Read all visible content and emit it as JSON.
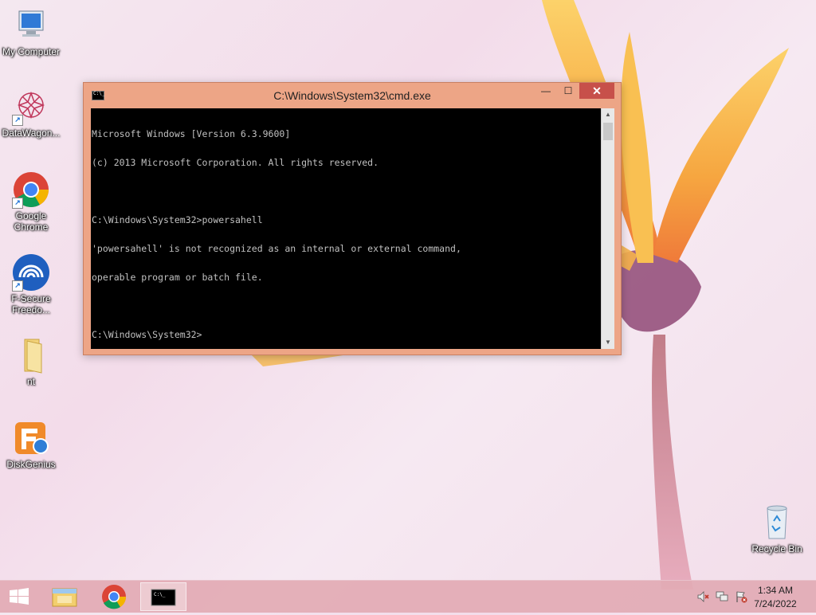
{
  "desktop": {
    "icons": [
      {
        "label": "My Computer"
      },
      {
        "label": "DataWagon..."
      },
      {
        "label": "Google Chrome"
      },
      {
        "label": "F-Secure Freedo..."
      },
      {
        "label": "nt"
      },
      {
        "label": "DiskGenius"
      },
      {
        "label": "Recycle Bin"
      }
    ]
  },
  "cmd_window": {
    "title": "C:\\Windows\\System32\\cmd.exe",
    "icon_text": "C:\\_",
    "buttons": {
      "minimize": "—",
      "maximize": "☐",
      "close": "✕"
    },
    "console_lines": [
      "Microsoft Windows [Version 6.3.9600]",
      "(c) 2013 Microsoft Corporation. All rights reserved.",
      "",
      "C:\\Windows\\System32>powersahell",
      "'powersahell' is not recognized as an internal or external command,",
      "operable program or batch file.",
      "",
      "C:\\Windows\\System32>"
    ]
  },
  "taskbar": {
    "items": [
      {
        "name": "file-explorer"
      },
      {
        "name": "google-chrome"
      },
      {
        "name": "command-prompt"
      }
    ],
    "clock": {
      "time": "1:34 AM",
      "date": "7/24/2022"
    }
  },
  "colors": {
    "window_frame": "#eda586",
    "close_button": "#c7504a",
    "console_bg": "#000000",
    "console_fg": "#c0c0c0"
  }
}
